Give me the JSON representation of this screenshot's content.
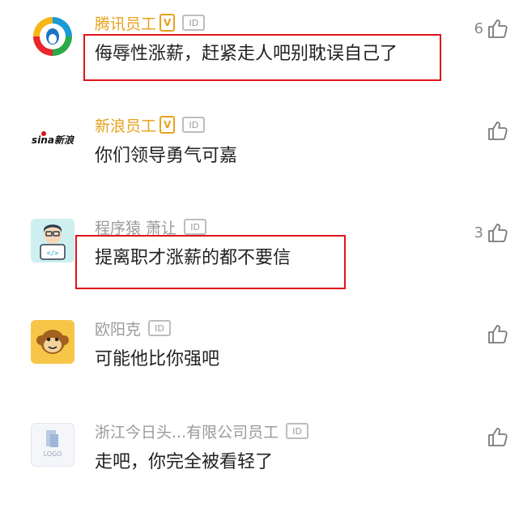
{
  "comments": [
    {
      "name": "腾讯员工",
      "verified": true,
      "v_badge": "V",
      "id_badge": "ID",
      "text": "侮辱性涨薪，赶紧走人吧别耽误自己了",
      "likes": "6"
    },
    {
      "name": "新浪员工",
      "verified": true,
      "v_badge": "V",
      "id_badge": "ID",
      "text": "你们领导勇气可嘉",
      "likes": "",
      "avatar_text": "sina新浪"
    },
    {
      "name": "程序猿 萧让",
      "verified": false,
      "id_badge": "ID",
      "text": "提离职才涨薪的都不要信",
      "likes": "3",
      "avatar_text": "</>"
    },
    {
      "name": "欧阳克",
      "verified": false,
      "id_badge": "ID",
      "text": "可能他比你强吧",
      "likes": ""
    },
    {
      "name": "浙江今日头...有限公司员工",
      "verified": false,
      "id_badge": "ID",
      "text": "走吧，你完全被看轻了",
      "likes": "",
      "avatar_text": "LOGO"
    }
  ],
  "colors": {
    "employee_name": "#e7a21c",
    "plain_name": "#9a9a9a",
    "highlight": "#e0141a"
  }
}
